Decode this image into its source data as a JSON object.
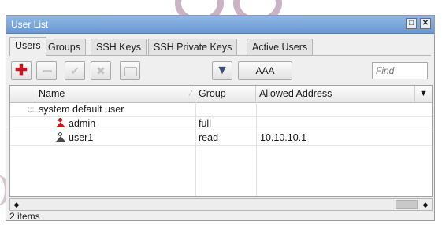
{
  "window": {
    "title": "User List"
  },
  "tabs": [
    {
      "label": "Users",
      "active": true
    },
    {
      "label": "Groups",
      "active": false
    },
    {
      "label": "SSH Keys",
      "active": false
    },
    {
      "label": "SSH Private Keys",
      "active": false
    },
    {
      "label": "Active Users",
      "active": false
    }
  ],
  "toolbar": {
    "aaa_label": "AAA",
    "find_placeholder": "Find",
    "icons": [
      "add-icon",
      "remove-icon",
      "enable-icon",
      "disable-icon",
      "comment-icon",
      "filter-icon"
    ]
  },
  "table": {
    "columns": [
      "Name",
      "Group",
      "Allowed Address"
    ],
    "section_label": "system default user",
    "rows": [
      {
        "name": "admin",
        "group": "full",
        "address": "",
        "icon": "user-red-icon"
      },
      {
        "name": "user1",
        "group": "read",
        "address": "10.10.10.1",
        "icon": "user-outline-icon"
      }
    ]
  },
  "status": {
    "items": "2 items"
  },
  "colors": {
    "titlebar": "#7fa7dc",
    "add": "#c8141c"
  }
}
